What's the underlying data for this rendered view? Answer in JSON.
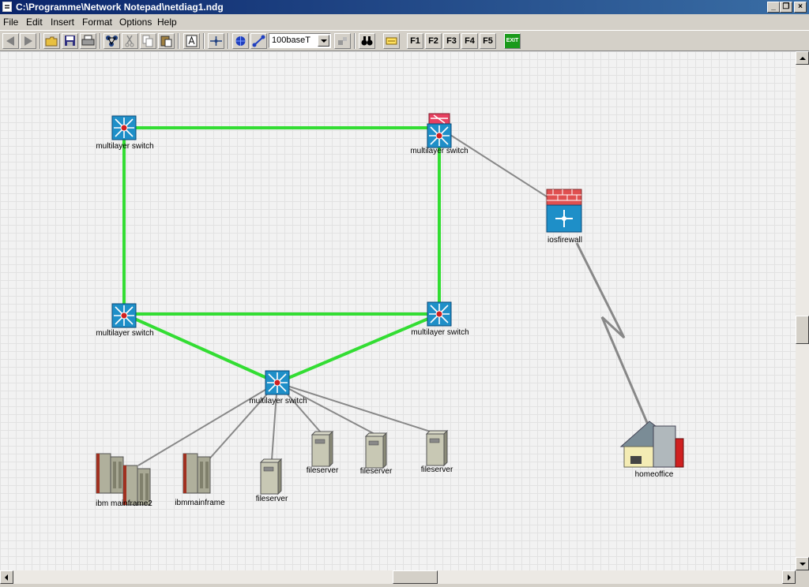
{
  "window": {
    "title": "C:\\Programme\\Network Notepad\\netdiag1.ndg"
  },
  "menu": {
    "items": [
      "File",
      "Edit",
      "Insert",
      "Format",
      "Options",
      "Help"
    ]
  },
  "toolbar": {
    "line_type": "100baseT",
    "f1": "F1",
    "f2": "F2",
    "f3": "F3",
    "f4": "F4",
    "f5": "F5",
    "exit": "EXIT"
  },
  "diagram": {
    "link_colors": {
      "ethernet": "#33dd33",
      "serial": "#888888"
    },
    "nodes": [
      {
        "id": "sw-top-left",
        "type": "multilayer-switch",
        "label": "multilayer switch"
      },
      {
        "id": "sw-top-right",
        "type": "multilayer-switch-firewall",
        "label": "multilayer switch"
      },
      {
        "id": "sw-mid-left",
        "type": "multilayer-switch",
        "label": "multilayer switch"
      },
      {
        "id": "sw-mid-right",
        "type": "multilayer-switch",
        "label": "multilayer switch"
      },
      {
        "id": "sw-bottom",
        "type": "multilayer-switch",
        "label": "multilayer switch"
      },
      {
        "id": "iosfirewall",
        "type": "firewall",
        "label": "iosfirewall"
      },
      {
        "id": "homeoffice",
        "type": "house",
        "label": "homeoffice"
      },
      {
        "id": "ibm-mainframe2",
        "type": "mainframe",
        "label": "ibm mainframe2"
      },
      {
        "id": "ibmmainframe",
        "type": "mainframe",
        "label": "ibmmainframe"
      },
      {
        "id": "fileserver-1",
        "type": "server",
        "label": "fileserver"
      },
      {
        "id": "fileserver-2",
        "type": "server",
        "label": "fileserver"
      },
      {
        "id": "fileserver-3",
        "type": "server",
        "label": "fileserver"
      },
      {
        "id": "fileserver-4",
        "type": "server",
        "label": "fileserver"
      }
    ]
  }
}
